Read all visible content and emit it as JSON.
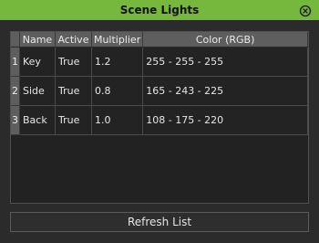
{
  "window": {
    "title": "Scene Lights",
    "accent_color": "#76b73d",
    "close_icon": "close-circle-icon"
  },
  "table": {
    "columns": [
      "Name",
      "Active",
      "Multiplier",
      "Color (RGB)"
    ],
    "rows": [
      {
        "index": "1",
        "name": "Key",
        "active": "True",
        "multiplier": "1.2",
        "color": "255 - 255 - 255"
      },
      {
        "index": "2",
        "name": "Side",
        "active": "True",
        "multiplier": "0.8",
        "color": "165 - 243 - 225"
      },
      {
        "index": "3",
        "name": "Back",
        "active": "True",
        "multiplier": "1.0",
        "color": "108 - 175 - 220"
      }
    ]
  },
  "footer": {
    "refresh_label": "Refresh List"
  }
}
